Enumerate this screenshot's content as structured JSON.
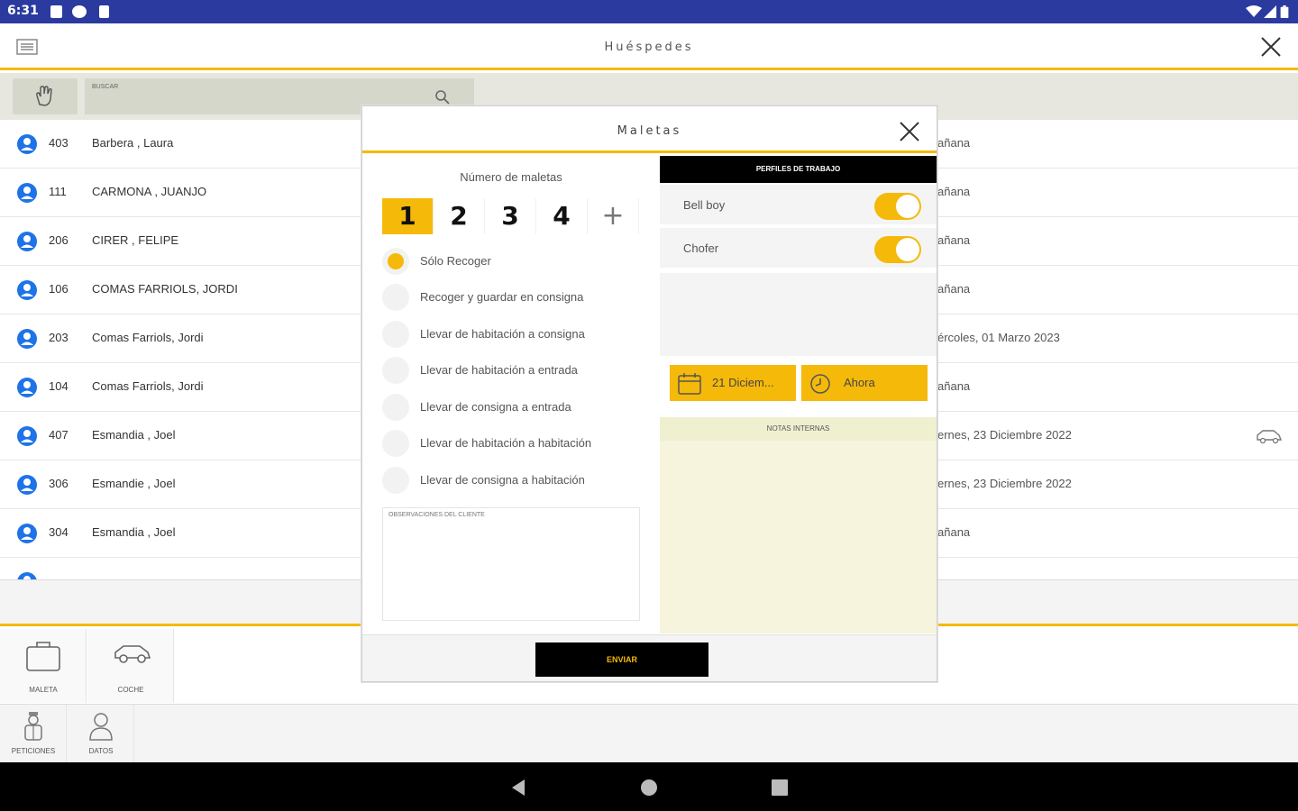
{
  "status_bar": {
    "time": "6:31"
  },
  "header": {
    "title": "Huéspedes"
  },
  "search": {
    "placeholder": "BUSCAR"
  },
  "guests": [
    {
      "room": "403",
      "name": "Barbera , Laura",
      "date": "añana"
    },
    {
      "room": "111",
      "name": "CARMONA , JUANJO",
      "date": "añana"
    },
    {
      "room": "206",
      "name": "CIRER , FELIPE",
      "date": "añana"
    },
    {
      "room": "106",
      "name": "COMAS FARRIOLS, JORDI",
      "date": "añana"
    },
    {
      "room": "203",
      "name": "Comas Farriols, Jordi",
      "date": "ércoles, 01 Marzo 2023"
    },
    {
      "room": "104",
      "name": "Comas Farriols, Jordi",
      "date": "añana"
    },
    {
      "room": "407",
      "name": "Esmandia , Joel",
      "date": "ernes, 23 Diciembre 2022"
    },
    {
      "room": "306",
      "name": "Esmandie , Joel",
      "date": "ernes, 23 Diciembre 2022"
    },
    {
      "room": "304",
      "name": "Esmandia , Joel",
      "date": "añana"
    }
  ],
  "tools": {
    "maleta": "MALETA",
    "coche": "COCHE",
    "peticiones": "PETICIONES",
    "datos": "DATOS"
  },
  "modal": {
    "title": "Maletas",
    "count_label": "Número de maletas",
    "counts": [
      "1",
      "2",
      "3",
      "4",
      "+"
    ],
    "selected_count": "1",
    "options": [
      {
        "label": "Sólo Recoger",
        "selected": true
      },
      {
        "label": "Recoger y guardar en consigna",
        "selected": false
      },
      {
        "label": "Llevar de habitación a consigna",
        "selected": false
      },
      {
        "label": "Llevar de habitación a entrada",
        "selected": false
      },
      {
        "label": "Llevar de consigna a entrada",
        "selected": false
      },
      {
        "label": "Llevar de habitación a habitación",
        "selected": false
      },
      {
        "label": "Llevar de consigna a habitación",
        "selected": false
      }
    ],
    "observations_label": "OBSERVACIONES DEL CLIENTE",
    "profiles_header": "PERFILES DE TRABAJO",
    "profiles": [
      {
        "label": "Bell boy",
        "on": true
      },
      {
        "label": "Chofer",
        "on": true
      }
    ],
    "date_button": "21 Diciem...",
    "time_button": "Ahora",
    "notes_header": "NOTAS INTERNAS",
    "send_label": "ENVIAR"
  },
  "colors": {
    "accent": "#f5b90a",
    "status_bar": "#2b3a9e",
    "avatar": "#1e73e8",
    "notes_bg": "#f6f4dc"
  }
}
